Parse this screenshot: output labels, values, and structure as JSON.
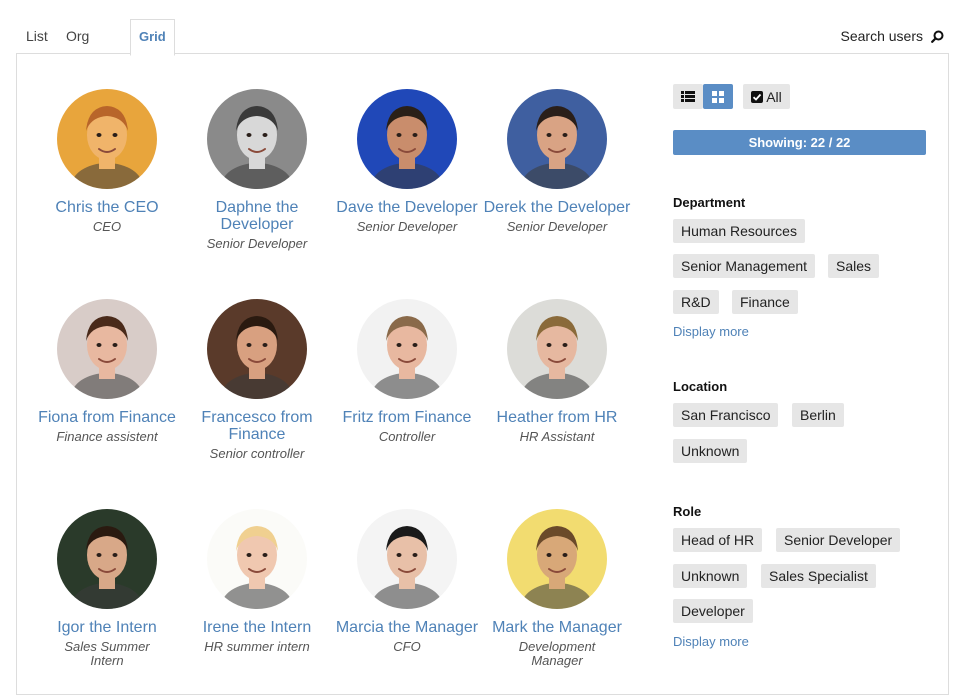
{
  "tabs": [
    "List",
    "Org chart",
    "Grid"
  ],
  "search_label": "Search users",
  "people": [
    {
      "name": "Chris the CEO",
      "role": "CEO",
      "bg": "#e8a53c",
      "skin": "#f0b46a",
      "hair": "#b8652a"
    },
    {
      "name": "Daphne the Developer",
      "role": "Senior Developer",
      "bg": "#8a8a8a",
      "skin": "#d8d8d8",
      "hair": "#3a3a3a"
    },
    {
      "name": "Dave the Developer",
      "role": "Senior Developer",
      "bg": "#2048b8",
      "skin": "#c98d6c",
      "hair": "#2a2018"
    },
    {
      "name": "Derek the Developer",
      "role": "Senior Developer",
      "bg": "#3f5fa0",
      "skin": "#d9a384",
      "hair": "#2a1f1a"
    },
    {
      "name": "Fiona from Finance",
      "role": "Finance assistent",
      "bg": "#d8ccc8",
      "skin": "#e8b8a0",
      "hair": "#4a2a1a"
    },
    {
      "name": "Francesco from Finance",
      "role": "Senior controller",
      "bg": "#5a3a2a",
      "skin": "#d8a080",
      "hair": "#2a1a10"
    },
    {
      "name": "Fritz from Finance",
      "role": "Controller",
      "bg": "#f2f2f2",
      "skin": "#e8b8a0",
      "hair": "#8a6a4a"
    },
    {
      "name": "Heather from HR",
      "role": "HR Assistant",
      "bg": "#dcdcd8",
      "skin": "#e6b8a0",
      "hair": "#8a6a3a"
    },
    {
      "name": "Igor the Intern",
      "role": "Sales Summer Intern",
      "bg": "#2a3a2a",
      "skin": "#d8a888",
      "hair": "#2a1a10"
    },
    {
      "name": "Irene the Intern",
      "role": "HR summer intern",
      "bg": "#fbfbf8",
      "skin": "#f0c8b0",
      "hair": "#f0d090"
    },
    {
      "name": "Marcia the Manager",
      "role": "CFO",
      "bg": "#f4f4f4",
      "skin": "#e8c0a8",
      "hair": "#1a1a1a"
    },
    {
      "name": "Mark the Manager",
      "role": "Development Manager",
      "bg": "#f2dc70",
      "skin": "#d8a878",
      "hair": "#6a4a2a"
    }
  ],
  "controls": {
    "all_label": "All",
    "showing": "Showing: 22 / 22"
  },
  "facets": {
    "department": {
      "title": "Department",
      "chips": [
        "Human Resources",
        "Senior Management",
        "Sales",
        "R&D",
        "Finance"
      ],
      "more": "Display more"
    },
    "location": {
      "title": "Location",
      "chips": [
        "San Francisco",
        "Berlin",
        "Unknown"
      ]
    },
    "role": {
      "title": "Role",
      "chips": [
        "Head of HR",
        "Senior Developer",
        "Unknown",
        "Sales Specialist",
        "Developer"
      ],
      "more": "Display more"
    }
  },
  "colors": {
    "accent": "#4f82b7",
    "showing_bar": "#5a8dc5",
    "chip_bg": "#e6e6e6"
  }
}
